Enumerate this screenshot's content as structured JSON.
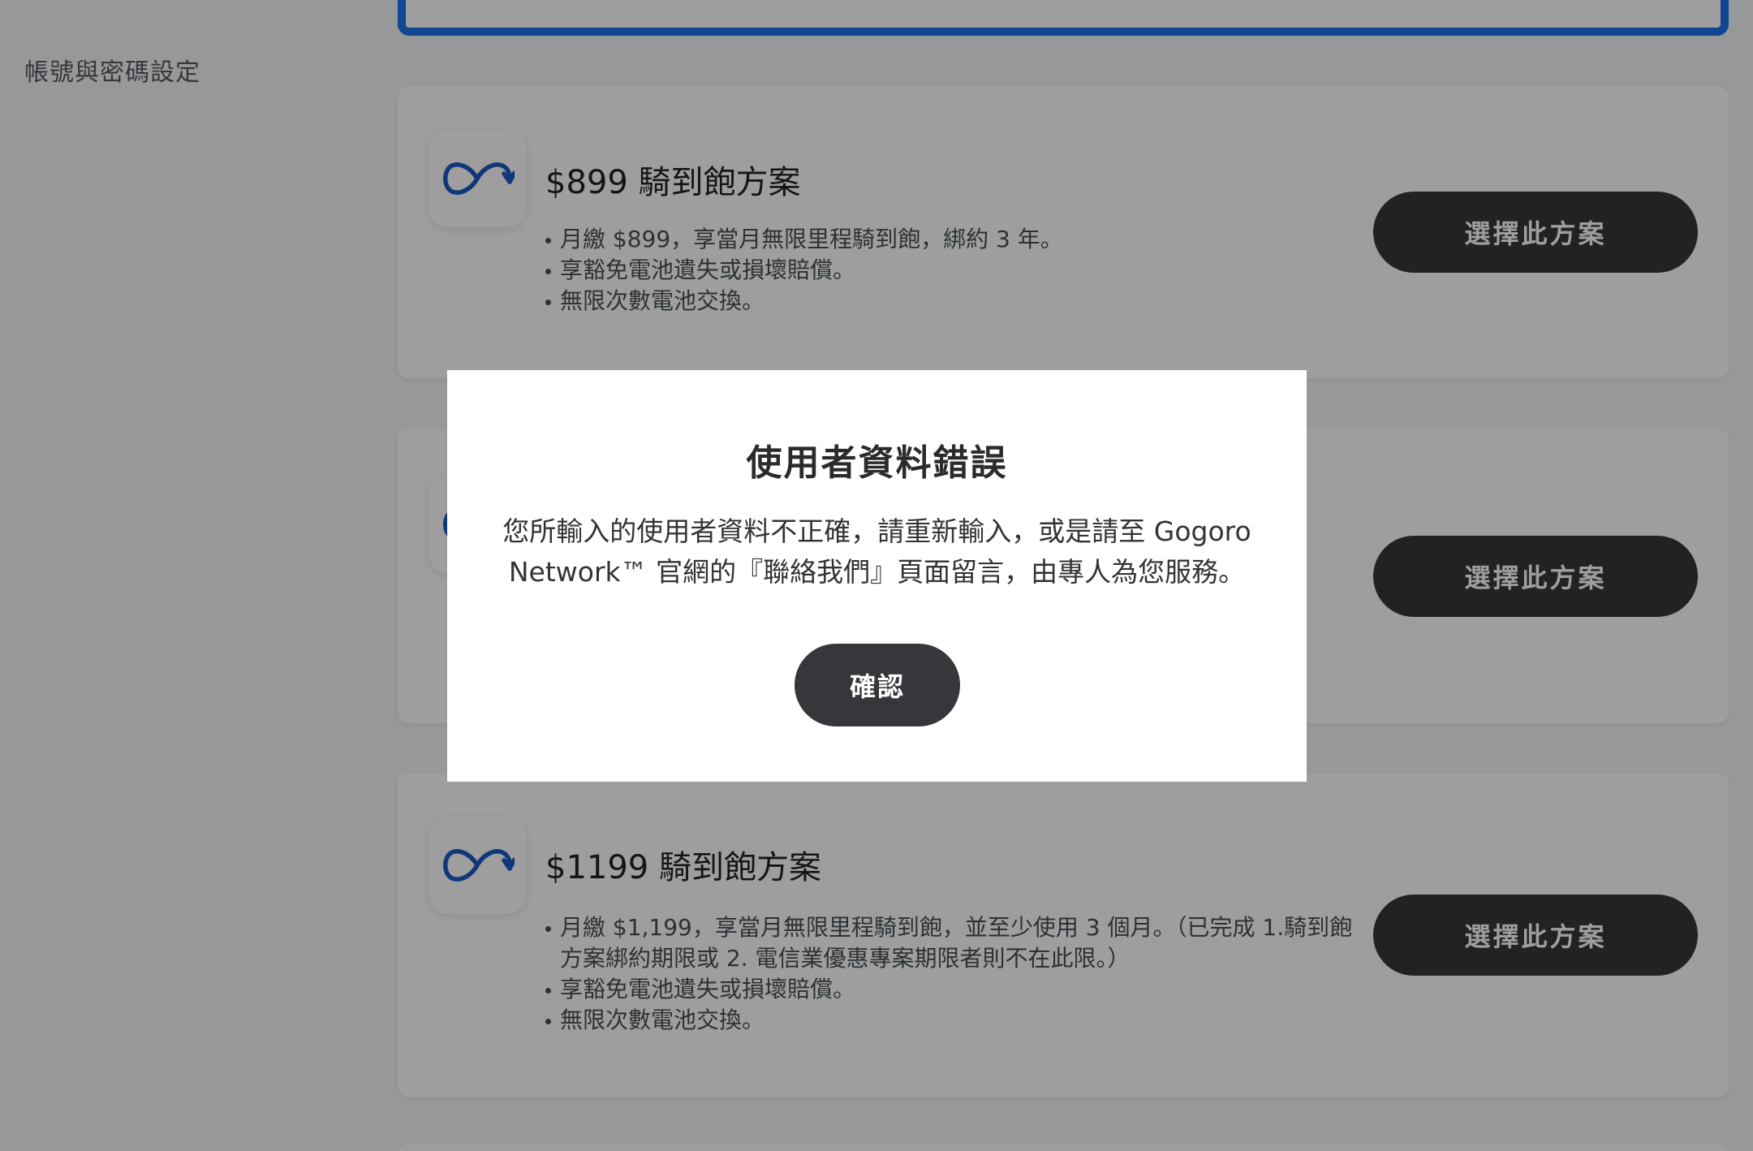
{
  "sidebar": {
    "account_settings_label": "帳號與密碼設定"
  },
  "plans": [
    {
      "title": "$899 騎到飽方案",
      "bullets": [
        "月繳 $899，享當月無限里程騎到飽，綁約 3 年。",
        "享豁免電池遺失或損壞賠償。",
        "無限次數電池交換。"
      ],
      "button_label": "選擇此方案",
      "icon": "infinity-refresh-icon"
    },
    {
      "title": "",
      "bullets": [],
      "button_label": "選擇此方案",
      "icon": "infinity-refresh-icon"
    },
    {
      "title": "$1199 騎到飽方案",
      "bullets": [
        "月繳 $1,199，享當月無限里程騎到飽，並至少使用 3 個月。（已完成 1.騎到飽方案綁約期限或 2. 電信業優惠專案期限者則不在此限。）",
        "享豁免電池遺失或損壞賠償。",
        "無限次數電池交換。"
      ],
      "button_label": "選擇此方案",
      "icon": "infinity-refresh-icon"
    }
  ],
  "modal": {
    "title": "使用者資料錯誤",
    "message": "您所輸入的使用者資料不正確，請重新輸入，或是請至 Gogoro Network™ 官網的『聯絡我們』頁面留言，由專人為您服務。",
    "confirm_label": "確認"
  },
  "colors": {
    "accent_blue": "#1a73e8",
    "button_dark": "#36373b",
    "overlay": "rgba(0,0,0,0.38)"
  }
}
